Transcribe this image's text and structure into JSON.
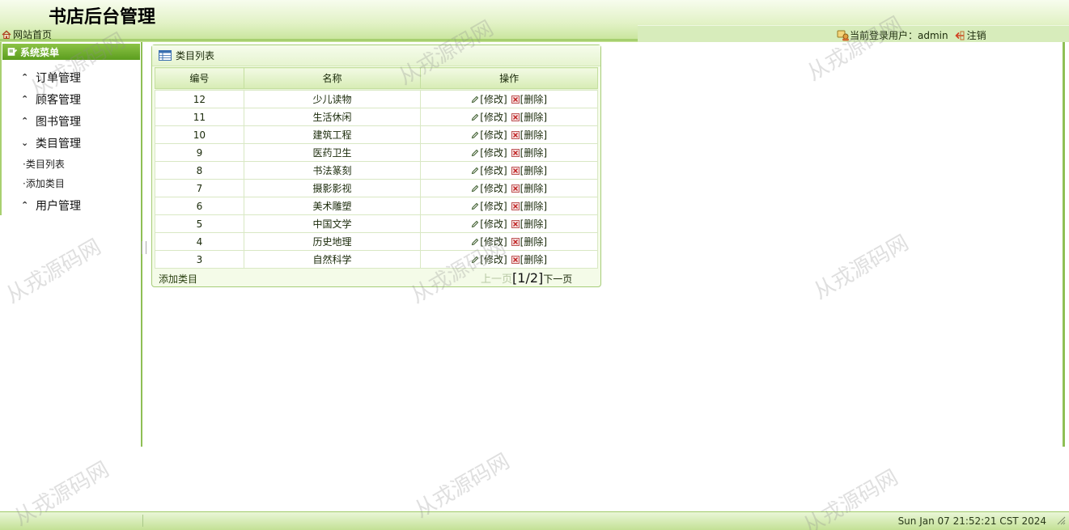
{
  "header": {
    "title": "书店后台管理",
    "home_link": "网站首页",
    "user_label": "当前登录用户：admin",
    "logout": "注销"
  },
  "sidebar": {
    "title": "系统菜单",
    "items": [
      {
        "label": "订单管理",
        "icon": "chevron-up-double-icon"
      },
      {
        "label": "顾客管理",
        "icon": "chevron-up-double-icon"
      },
      {
        "label": "图书管理",
        "icon": "chevron-up-double-icon"
      },
      {
        "label": "类目管理",
        "icon": "chevron-down-double-icon"
      },
      {
        "label": "用户管理",
        "icon": "chevron-up-double-icon"
      }
    ],
    "sub_items": [
      "·类目列表",
      "·添加类目"
    ]
  },
  "panel": {
    "title": "类目列表",
    "columns": [
      "编号",
      "名称",
      "操作"
    ],
    "rows": [
      {
        "id": "12",
        "name": "少儿读物"
      },
      {
        "id": "11",
        "name": "生活休闲"
      },
      {
        "id": "10",
        "name": "建筑工程"
      },
      {
        "id": "9",
        "name": "医药卫生"
      },
      {
        "id": "8",
        "name": "书法篆刻"
      },
      {
        "id": "7",
        "name": "摄影影视"
      },
      {
        "id": "6",
        "name": "美术雕塑"
      },
      {
        "id": "5",
        "name": "中国文学"
      },
      {
        "id": "4",
        "name": "历史地理"
      },
      {
        "id": "3",
        "name": "自然科学"
      }
    ],
    "edit_label": "[修改]",
    "delete_label": "[删除]",
    "add_link": "添加类目",
    "pager": {
      "prev": "上一页",
      "info": "[1/2]",
      "next": "下一页"
    }
  },
  "footer": {
    "time": "Sun Jan 07 21:52:21 CST 2024"
  },
  "watermark": "从戎源码网",
  "colors": {
    "accent_green": "#5b9d1e",
    "border_green": "#8fbf55",
    "header_bg": "#e2f2c6"
  }
}
